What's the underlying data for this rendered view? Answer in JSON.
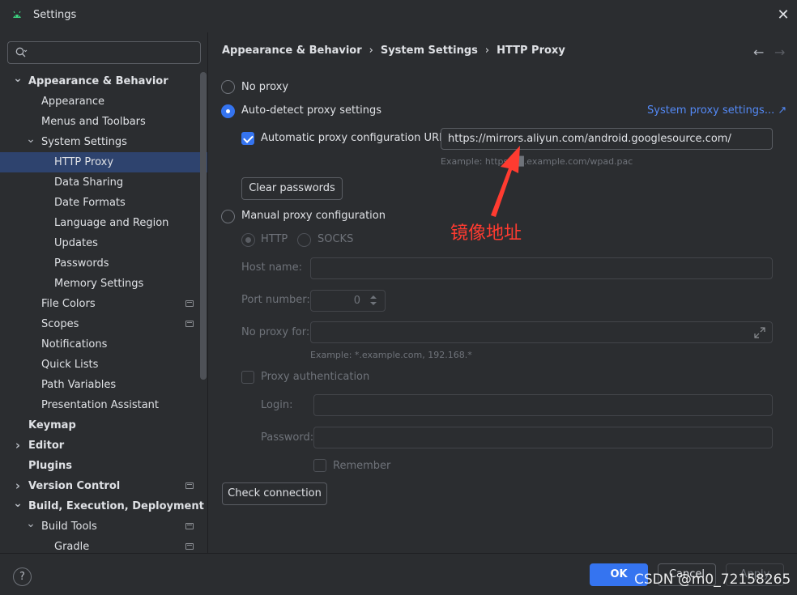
{
  "window": {
    "title": "Settings",
    "close_symbol": "✕"
  },
  "sidebar": {
    "search_placeholder": "",
    "items": [
      {
        "label": "Appearance & Behavior",
        "level": 0,
        "bold": true,
        "chevron": "down"
      },
      {
        "label": "Appearance",
        "level": 1
      },
      {
        "label": "Menus and Toolbars",
        "level": 1
      },
      {
        "label": "System Settings",
        "level": 1,
        "chevron": "down"
      },
      {
        "label": "HTTP Proxy",
        "level": 2,
        "selected": true
      },
      {
        "label": "Data Sharing",
        "level": 2
      },
      {
        "label": "Date Formats",
        "level": 2
      },
      {
        "label": "Language and Region",
        "level": 2
      },
      {
        "label": "Updates",
        "level": 2
      },
      {
        "label": "Passwords",
        "level": 2
      },
      {
        "label": "Memory Settings",
        "level": 2
      },
      {
        "label": "File Colors",
        "level": 1,
        "badge": true
      },
      {
        "label": "Scopes",
        "level": 1,
        "badge": true
      },
      {
        "label": "Notifications",
        "level": 1
      },
      {
        "label": "Quick Lists",
        "level": 1
      },
      {
        "label": "Path Variables",
        "level": 1
      },
      {
        "label": "Presentation Assistant",
        "level": 1
      },
      {
        "label": "Keymap",
        "level": 0,
        "bold": true
      },
      {
        "label": "Editor",
        "level": 0,
        "bold": true,
        "chevron": "right"
      },
      {
        "label": "Plugins",
        "level": 0,
        "bold": true
      },
      {
        "label": "Version Control",
        "level": 0,
        "bold": true,
        "chevron": "right",
        "badge": true
      },
      {
        "label": "Build, Execution, Deployment",
        "level": 0,
        "bold": true,
        "chevron": "down"
      },
      {
        "label": "Build Tools",
        "level": 1,
        "chevron": "down",
        "badge": true
      },
      {
        "label": "Gradle",
        "level": 2,
        "badge": true
      }
    ]
  },
  "breadcrumb": {
    "part1": "Appearance & Behavior",
    "part2": "System Settings",
    "part3": "HTTP Proxy",
    "separator": "›"
  },
  "proxy": {
    "no_proxy_label": "No proxy",
    "auto_detect_label": "Auto-detect proxy settings",
    "system_proxy_link": "System proxy settings... ↗",
    "auto_config_url_label": "Automatic proxy configuration URL:",
    "auto_config_url_value": "https://mirrors.aliyun.com/android.googlesource.com/",
    "auto_config_example": "Example: https://█.example.com/wpad.pac",
    "clear_passwords_label": "Clear passwords",
    "manual_label": "Manual proxy configuration",
    "http_label": "HTTP",
    "socks_label": "SOCKS",
    "host_name_label": "Host name:",
    "port_number_label": "Port number:",
    "port_value": "0",
    "no_proxy_for_label": "No proxy for:",
    "no_proxy_example": "Example: *.example.com, 192.168.*",
    "proxy_auth_label": "Proxy authentication",
    "login_label": "Login:",
    "password_label": "Password:",
    "remember_label": "Remember",
    "check_connection_label": "Check connection"
  },
  "annotation": {
    "text": "镜像地址",
    "color": "#ff3b30"
  },
  "footer": {
    "help": "?",
    "ok": "OK",
    "cancel": "Cancel",
    "apply": "Apply"
  },
  "watermark": "CSDN @m0_72158265",
  "colors": {
    "accent": "#3574f0",
    "link": "#548af7",
    "selection": "#2e436e",
    "background": "#2b2d30"
  }
}
